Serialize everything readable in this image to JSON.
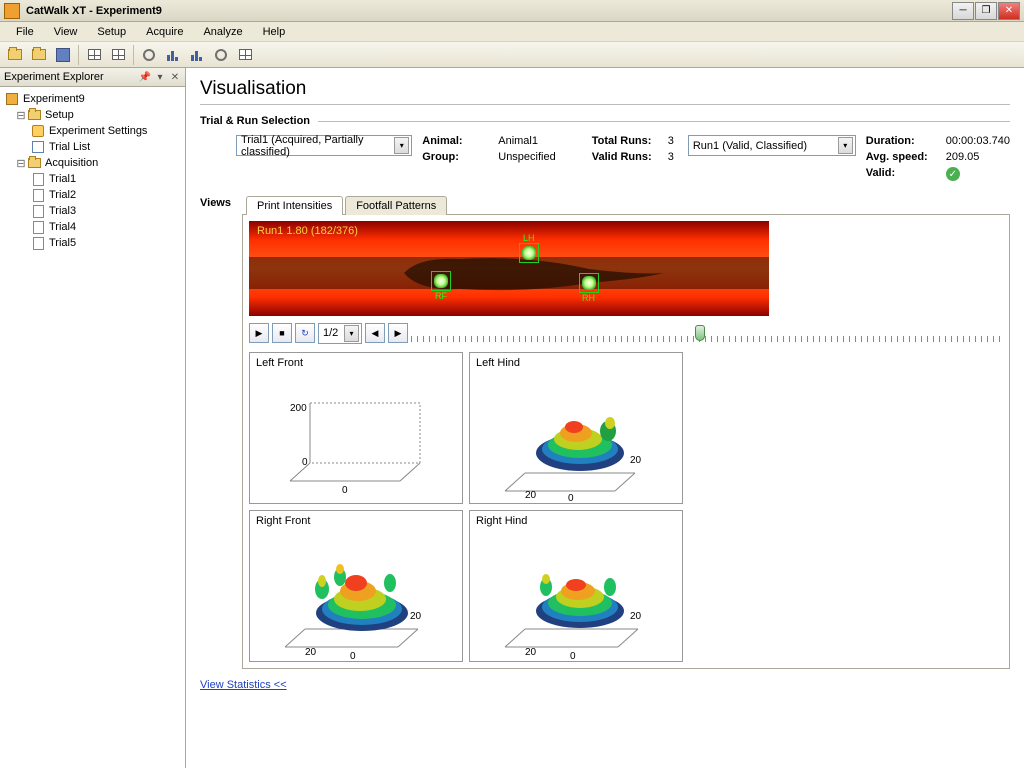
{
  "window": {
    "title": "CatWalk XT - Experiment9"
  },
  "menubar": [
    "File",
    "View",
    "Setup",
    "Acquire",
    "Analyze",
    "Help"
  ],
  "explorer": {
    "title": "Experiment Explorer",
    "root": "Experiment9",
    "setup": {
      "label": "Setup",
      "children": [
        "Experiment Settings",
        "Trial List"
      ]
    },
    "acquisition": {
      "label": "Acquisition",
      "trials": [
        "Trial1",
        "Trial2",
        "Trial3",
        "Trial4",
        "Trial5"
      ]
    }
  },
  "page": {
    "title": "Visualisation",
    "section_trial_run": "Trial & Run Selection",
    "section_views": "Views"
  },
  "trial_select": {
    "value": "Trial1 (Acquired, Partially classified)"
  },
  "animal": {
    "label": "Animal:",
    "value": "Animal1"
  },
  "group": {
    "label": "Group:",
    "value": "Unspecified"
  },
  "total_runs": {
    "label": "Total Runs:",
    "value": "3"
  },
  "valid_runs": {
    "label": "Valid Runs:",
    "value": "3"
  },
  "run_select": {
    "value": "Run1 (Valid, Classified)"
  },
  "duration": {
    "label": "Duration:",
    "value": "00:00:03.740"
  },
  "avg_speed": {
    "label": "Avg. speed:",
    "value": "209.05"
  },
  "valid": {
    "label": "Valid:"
  },
  "tabs": {
    "t1": "Print Intensities",
    "t2": "Footfall Patterns"
  },
  "runway": {
    "overlay": "Run1 1.80 (182/376)",
    "paws": {
      "rf": "RF",
      "lh": "LH",
      "rh": "RH"
    }
  },
  "playback": {
    "speed": "1/2"
  },
  "plots": {
    "lf": "Left Front",
    "lh": "Left Hind",
    "rf": "Right Front",
    "rh": "Right Hind",
    "axis0": "0",
    "axis20": "20",
    "axis200": "200"
  },
  "link": "View Statistics <<"
}
